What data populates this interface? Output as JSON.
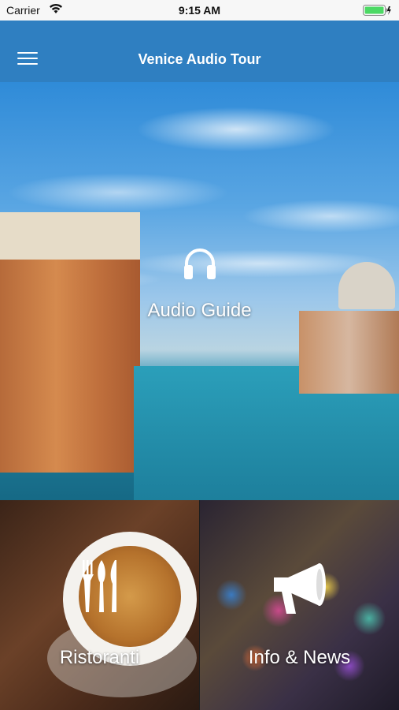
{
  "status_bar": {
    "carrier": "Carrier",
    "time": "9:15 AM"
  },
  "header": {
    "title": "Venice Audio Tour"
  },
  "tiles": [
    {
      "label": "Audio Guide",
      "icon": "headphones-icon"
    },
    {
      "label": "Ristoranti",
      "icon": "fork-knife-icon"
    },
    {
      "label": "Info & News",
      "icon": "megaphone-icon"
    }
  ],
  "colors": {
    "nav": "#2f7fc1",
    "battery": "#4cd964"
  }
}
